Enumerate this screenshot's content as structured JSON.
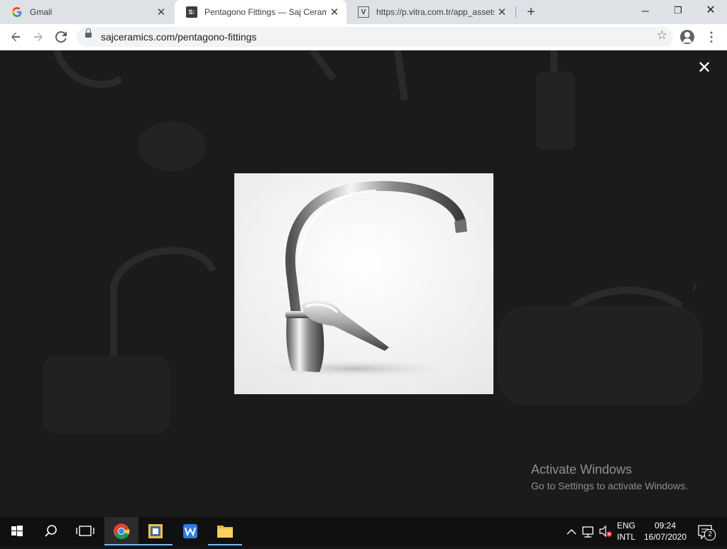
{
  "browser": {
    "tabs": [
      {
        "title": "Gmail",
        "favicon": "gmail-google-icon",
        "active": false
      },
      {
        "title": "Pentagono Fittings — Saj Ceramics",
        "favicon": "saj-ceramics-icon",
        "favicon_text": "S:",
        "active": true
      },
      {
        "title": "https://p.vitra.com.tr/app_assets/",
        "favicon": "vitra-icon",
        "favicon_text": "V",
        "active": false
      }
    ],
    "new_tab_symbol": "+",
    "window_controls": {
      "minimize": "─",
      "restore": "❐",
      "close": "✕"
    },
    "address": "sajceramics.com/pentagono-fittings"
  },
  "page": {
    "lightbox": {
      "close_symbol": "✕",
      "next_symbol": "›",
      "image": "faucet-mixer-photo"
    },
    "activation": {
      "title": "Activate Windows",
      "subtitle": "Go to Settings to activate Windows."
    }
  },
  "taskbar": {
    "apps": [
      "chrome-icon",
      "file-explorer-app-icon",
      "wps-writer-icon",
      "folder-icon"
    ],
    "tray": {
      "language": "ENG",
      "layout": "INTL",
      "time": "09:24",
      "date": "16/07/2020",
      "notification_count": "2"
    }
  },
  "colors": {
    "accent": "#76b9ed",
    "tab_strip": "#dee1e6",
    "taskbar": "#101010"
  }
}
